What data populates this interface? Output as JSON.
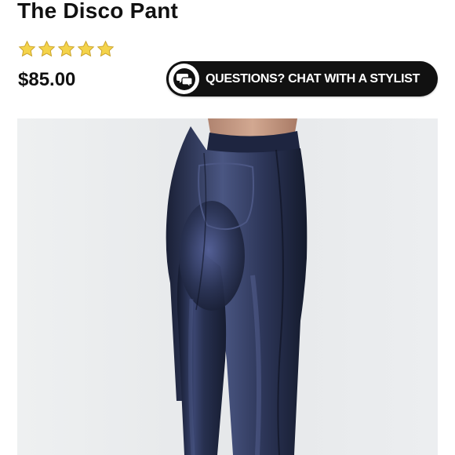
{
  "product": {
    "title": "The Disco Pant",
    "rating": {
      "stars_filled": 5,
      "stars_total": 5,
      "star_color": "#f3cf3d"
    },
    "price": "$85.00"
  },
  "chat_button": {
    "label": "QUESTIONS? CHAT WITH A STYLIST",
    "icon": "chat-bubbles-icon",
    "background": "#111111"
  },
  "image": {
    "subject": "product-photo",
    "pant_color": "#1f2640",
    "background_color": "#e9ebec"
  }
}
